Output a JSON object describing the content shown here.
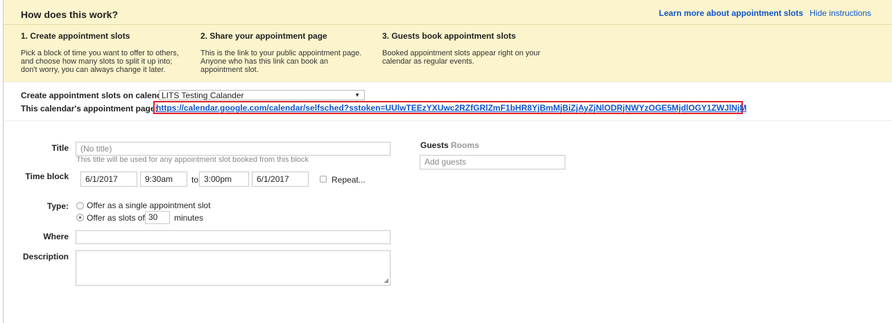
{
  "instructions": {
    "title": "How does this work?",
    "learn_more": "Learn more about appointment slots",
    "hide": "Hide instructions",
    "steps": [
      {
        "title": "1. Create appointment slots",
        "lines": [
          "Pick a block of time you want to offer to others,",
          "and choose how many slots to split it up into;",
          "don't worry, you can always change it later."
        ]
      },
      {
        "title": "2. Share your appointment page",
        "lines": [
          "This is the link to your public appointment page.",
          "Anyone who has this link can book an",
          "appointment slot."
        ]
      },
      {
        "title": "3. Guests book appointment slots",
        "lines": [
          "Booked appointment slots appear right on your",
          "calendar as regular events."
        ]
      }
    ]
  },
  "calendar": {
    "label": "Create appointment slots on calendar:",
    "selected": "LITS Testing Calander",
    "page_label": "This calendar's appointment page:",
    "page_url": "https://calendar.google.com/calendar/selfsched?sstoken=UUlwTEEzYXUwc2RZfGRlZmF1bHR8YjBmMjBiZjAyZjNlODRjNWYzOGE5MjdlOGY1ZWJlNjM"
  },
  "form": {
    "title_label": "Title",
    "title_placeholder": "(No title)",
    "title_hint": "This title will be used for any appointment slot booked from this block",
    "time_label": "Time block",
    "start_date": "6/1/2017",
    "start_time": "9:30am",
    "to": "to",
    "end_time": "3:00pm",
    "end_date": "6/1/2017",
    "repeat": "Repeat...",
    "type_label": "Type:",
    "type_single": "Offer as a single appointment slot",
    "type_slots": "Offer as slots of:",
    "slot_minutes": "30",
    "minutes": "minutes",
    "where_label": "Where",
    "description_label": "Description"
  },
  "side": {
    "tab_guests": "Guests",
    "tab_rooms": "Rooms",
    "add_guests_placeholder": "Add guests"
  }
}
